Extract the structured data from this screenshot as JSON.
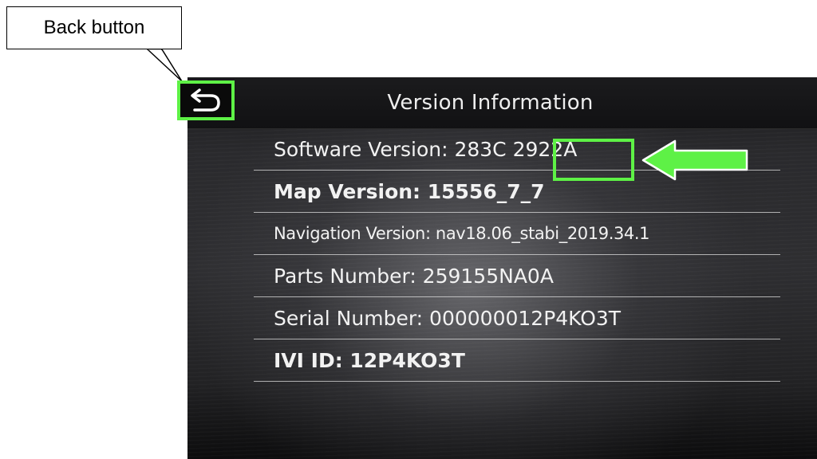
{
  "callout": {
    "label": "Back button"
  },
  "header": {
    "title": "Version Information",
    "back_icon": "back-arrow-icon"
  },
  "info_rows": [
    {
      "label": "Software Version: 283C 2922A"
    },
    {
      "label": "Map Version: 15556_7_7"
    },
    {
      "label": "Navigation Version: nav18.06_stabi_2019.34.1"
    },
    {
      "label": "Parts Number: 259155NA0A"
    },
    {
      "label": "Serial Number: 000000012P4KO3T"
    },
    {
      "label": "IVI ID: 12P4KO3T"
    }
  ],
  "annotations": {
    "highlight_color": "#5ef146",
    "pointer_icon": "left-arrow-icon"
  }
}
